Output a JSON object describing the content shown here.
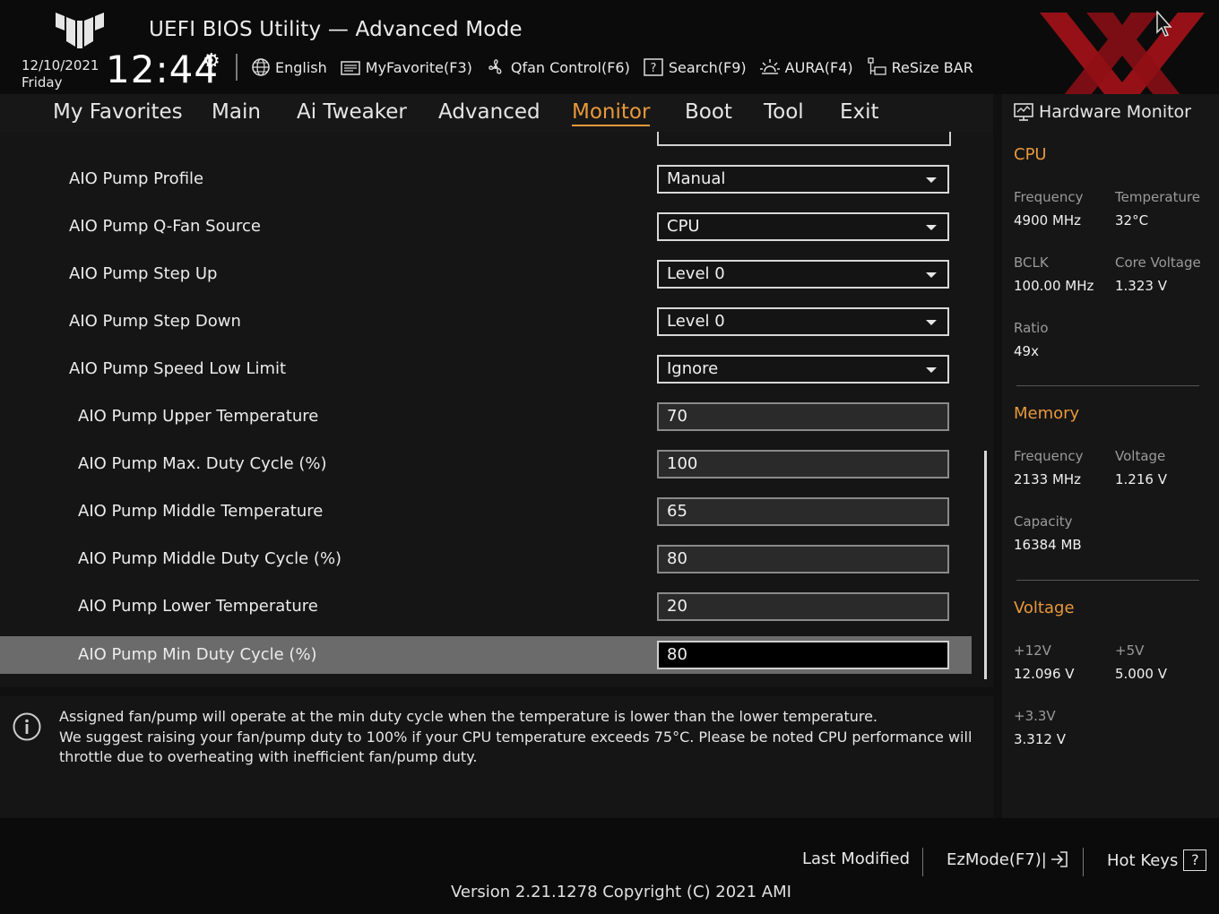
{
  "header": {
    "title": "UEFI BIOS Utility — Advanced Mode",
    "date": "12/10/2021",
    "day": "Friday",
    "time": "12:44",
    "toolbar": [
      {
        "icon": "globe-icon",
        "label": "English"
      },
      {
        "icon": "favorite-icon",
        "label": "MyFavorite(F3)"
      },
      {
        "icon": "fan-icon",
        "label": "Qfan Control(F6)"
      },
      {
        "icon": "search-help-icon",
        "label": "Search(F9)"
      },
      {
        "icon": "aura-icon",
        "label": "AURA(F4)"
      },
      {
        "icon": "resize-bar-icon",
        "label": "ReSize BAR"
      }
    ]
  },
  "menu": {
    "items": [
      "My Favorites",
      "Main",
      "Ai Tweaker",
      "Advanced",
      "Monitor",
      "Boot",
      "Tool",
      "Exit"
    ],
    "active": "Monitor"
  },
  "settings": [
    {
      "label": "AIO Pump Profile",
      "type": "dropdown",
      "value": "Manual"
    },
    {
      "label": "AIO Pump Q-Fan Source",
      "type": "dropdown",
      "value": "CPU"
    },
    {
      "label": "AIO Pump Step Up",
      "type": "dropdown",
      "value": "Level 0"
    },
    {
      "label": "AIO Pump Step Down",
      "type": "dropdown",
      "value": "Level 0"
    },
    {
      "label": "AIO Pump Speed Low Limit",
      "type": "dropdown",
      "value": "Ignore"
    },
    {
      "label": "AIO Pump Upper Temperature",
      "type": "number",
      "value": "70"
    },
    {
      "label": "AIO Pump Max. Duty Cycle (%)",
      "type": "number",
      "value": "100"
    },
    {
      "label": "AIO Pump Middle Temperature",
      "type": "number",
      "value": "65"
    },
    {
      "label": "AIO Pump Middle Duty Cycle (%)",
      "type": "number",
      "value": "80"
    },
    {
      "label": "AIO Pump Lower Temperature",
      "type": "number",
      "value": "20"
    },
    {
      "label": "AIO Pump Min Duty Cycle (%)",
      "type": "number",
      "value": "80"
    }
  ],
  "info": {
    "lines": [
      "Assigned fan/pump will operate at the min duty cycle when the temperature is lower than the lower temperature.",
      "We suggest raising your fan/pump duty to 100% if your CPU temperature exceeds 75°C. Please be noted CPU performance will",
      "throttle due to overheating with inefficient fan/pump duty."
    ]
  },
  "hw": {
    "title": "Hardware Monitor",
    "cpu": {
      "heading": "CPU",
      "frequency_label": "Frequency",
      "frequency": "4900 MHz",
      "temperature_label": "Temperature",
      "temperature": "32°C",
      "bclk_label": "BCLK",
      "bclk": "100.00 MHz",
      "core_voltage_label": "Core Voltage",
      "core_voltage": "1.323 V",
      "ratio_label": "Ratio",
      "ratio": "49x"
    },
    "memory": {
      "heading": "Memory",
      "frequency_label": "Frequency",
      "frequency": "2133 MHz",
      "voltage_label": "Voltage",
      "voltage": "1.216 V",
      "capacity_label": "Capacity",
      "capacity": "16384 MB"
    },
    "voltage": {
      "heading": "Voltage",
      "v12_label": "+12V",
      "v12": "12.096 V",
      "v5_label": "+5V",
      "v5": "5.000 V",
      "v33_label": "+3.3V",
      "v33": "3.312 V"
    }
  },
  "footer": {
    "last_modified": "Last Modified",
    "ezmode": "EzMode(F7)|",
    "hotkeys": "Hot Keys",
    "hotkeys_key": "?",
    "version": "Version 2.21.1278 Copyright (C) 2021 AMI"
  },
  "colors": {
    "accent": "#e8983b",
    "watermark": "#c0141c"
  }
}
